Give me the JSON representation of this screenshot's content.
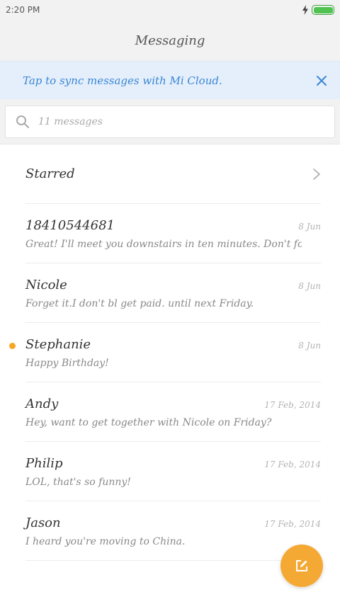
{
  "status_bar": {
    "time": "2:20 PM",
    "battery_level": 1.0
  },
  "header": {
    "title": "Messaging"
  },
  "sync_banner": {
    "text": "Tap to sync messages with Mi Cloud."
  },
  "search": {
    "placeholder": "11 messages"
  },
  "starred": {
    "label": "Starred"
  },
  "messages": [
    {
      "name": "18410544681",
      "date": "8 Jun",
      "preview": "Great! I'll meet you downstairs in ten minutes. Don't forge",
      "unread": false
    },
    {
      "name": "Nicole",
      "date": "8 Jun",
      "preview": "Forget it.I don't bl get paid. until next Friday.",
      "unread": false
    },
    {
      "name": "Stephanie",
      "date": "8 Jun",
      "preview": "Happy Birthday!",
      "unread": true
    },
    {
      "name": "Andy",
      "date": "17 Feb, 2014",
      "preview": "Hey, want to get together with Nicole on Friday?",
      "unread": false
    },
    {
      "name": "Philip",
      "date": "17 Feb, 2014",
      "preview": "LOL, that's so funny!",
      "unread": false
    },
    {
      "name": "Jason",
      "date": "17 Feb, 2014",
      "preview": "I heard you're moving to China.",
      "unread": false
    }
  ],
  "colors": {
    "accent": "#f5a935",
    "link": "#3b86d4",
    "unread_dot": "#f5a623"
  },
  "icons": {
    "search": "search-icon",
    "close": "close-icon",
    "chevron": "chevron-right-icon",
    "compose": "compose-icon"
  }
}
